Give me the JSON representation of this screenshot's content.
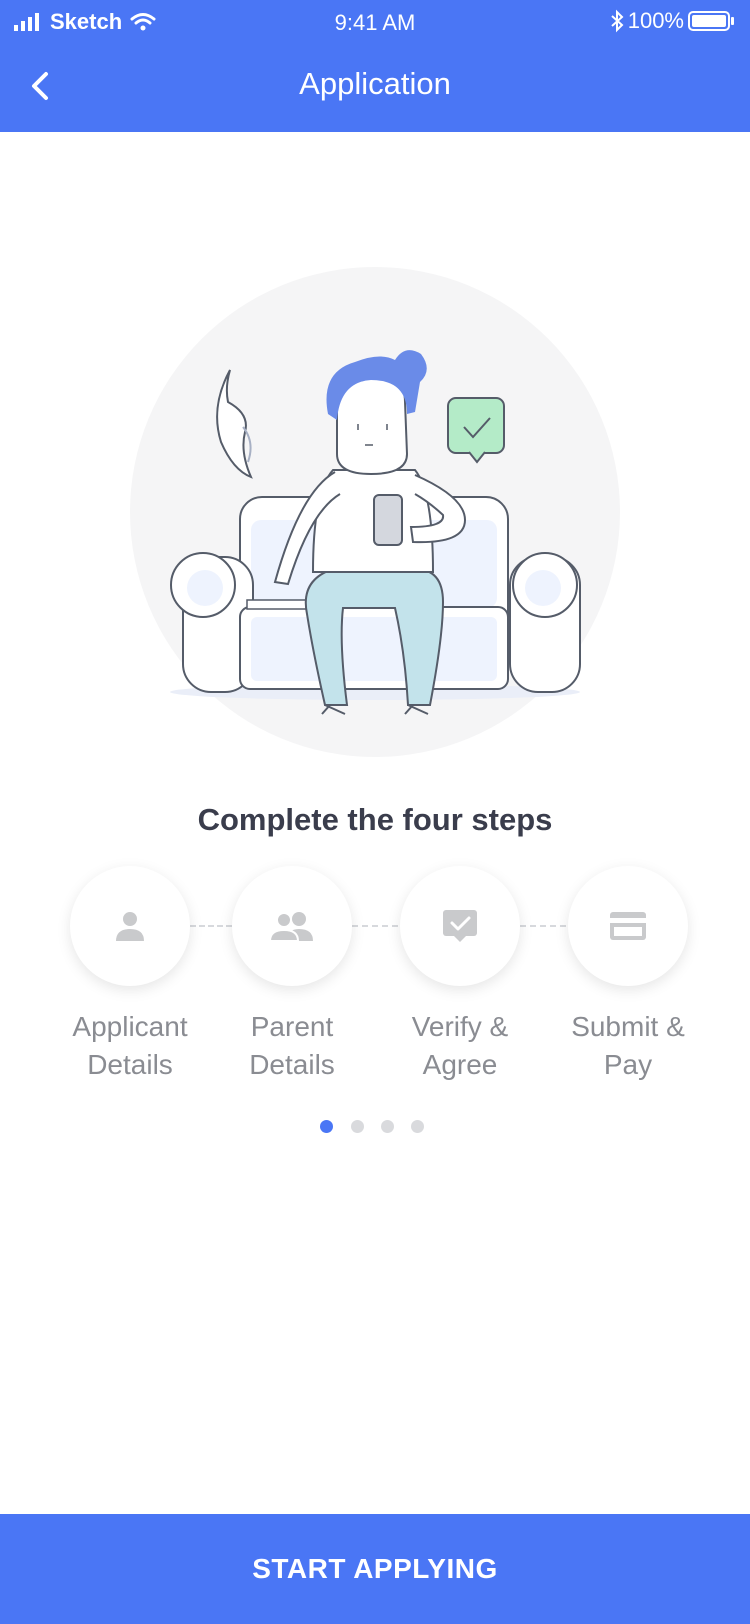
{
  "status_bar": {
    "carrier": "Sketch",
    "time": "9:41 AM",
    "battery": "100%"
  },
  "nav": {
    "title": "Application",
    "back_icon": "chevron-left-icon"
  },
  "headline": "Complete the four steps",
  "steps": [
    {
      "label": "Applicant\nDetails",
      "icon": "person-icon"
    },
    {
      "label": "Parent\nDetails",
      "icon": "people-icon"
    },
    {
      "label": "Verify &\nAgree",
      "icon": "check-bubble-icon"
    },
    {
      "label": "Submit &\nPay",
      "icon": "credit-card-icon"
    }
  ],
  "pagination": {
    "count": 4,
    "active_index": 0
  },
  "cta": {
    "label": "START APPLYING"
  },
  "colors": {
    "accent": "#4a76f5",
    "headline": "#3a3d4c",
    "step_label": "#8a8c92",
    "step_icon": "#c9cacc"
  }
}
